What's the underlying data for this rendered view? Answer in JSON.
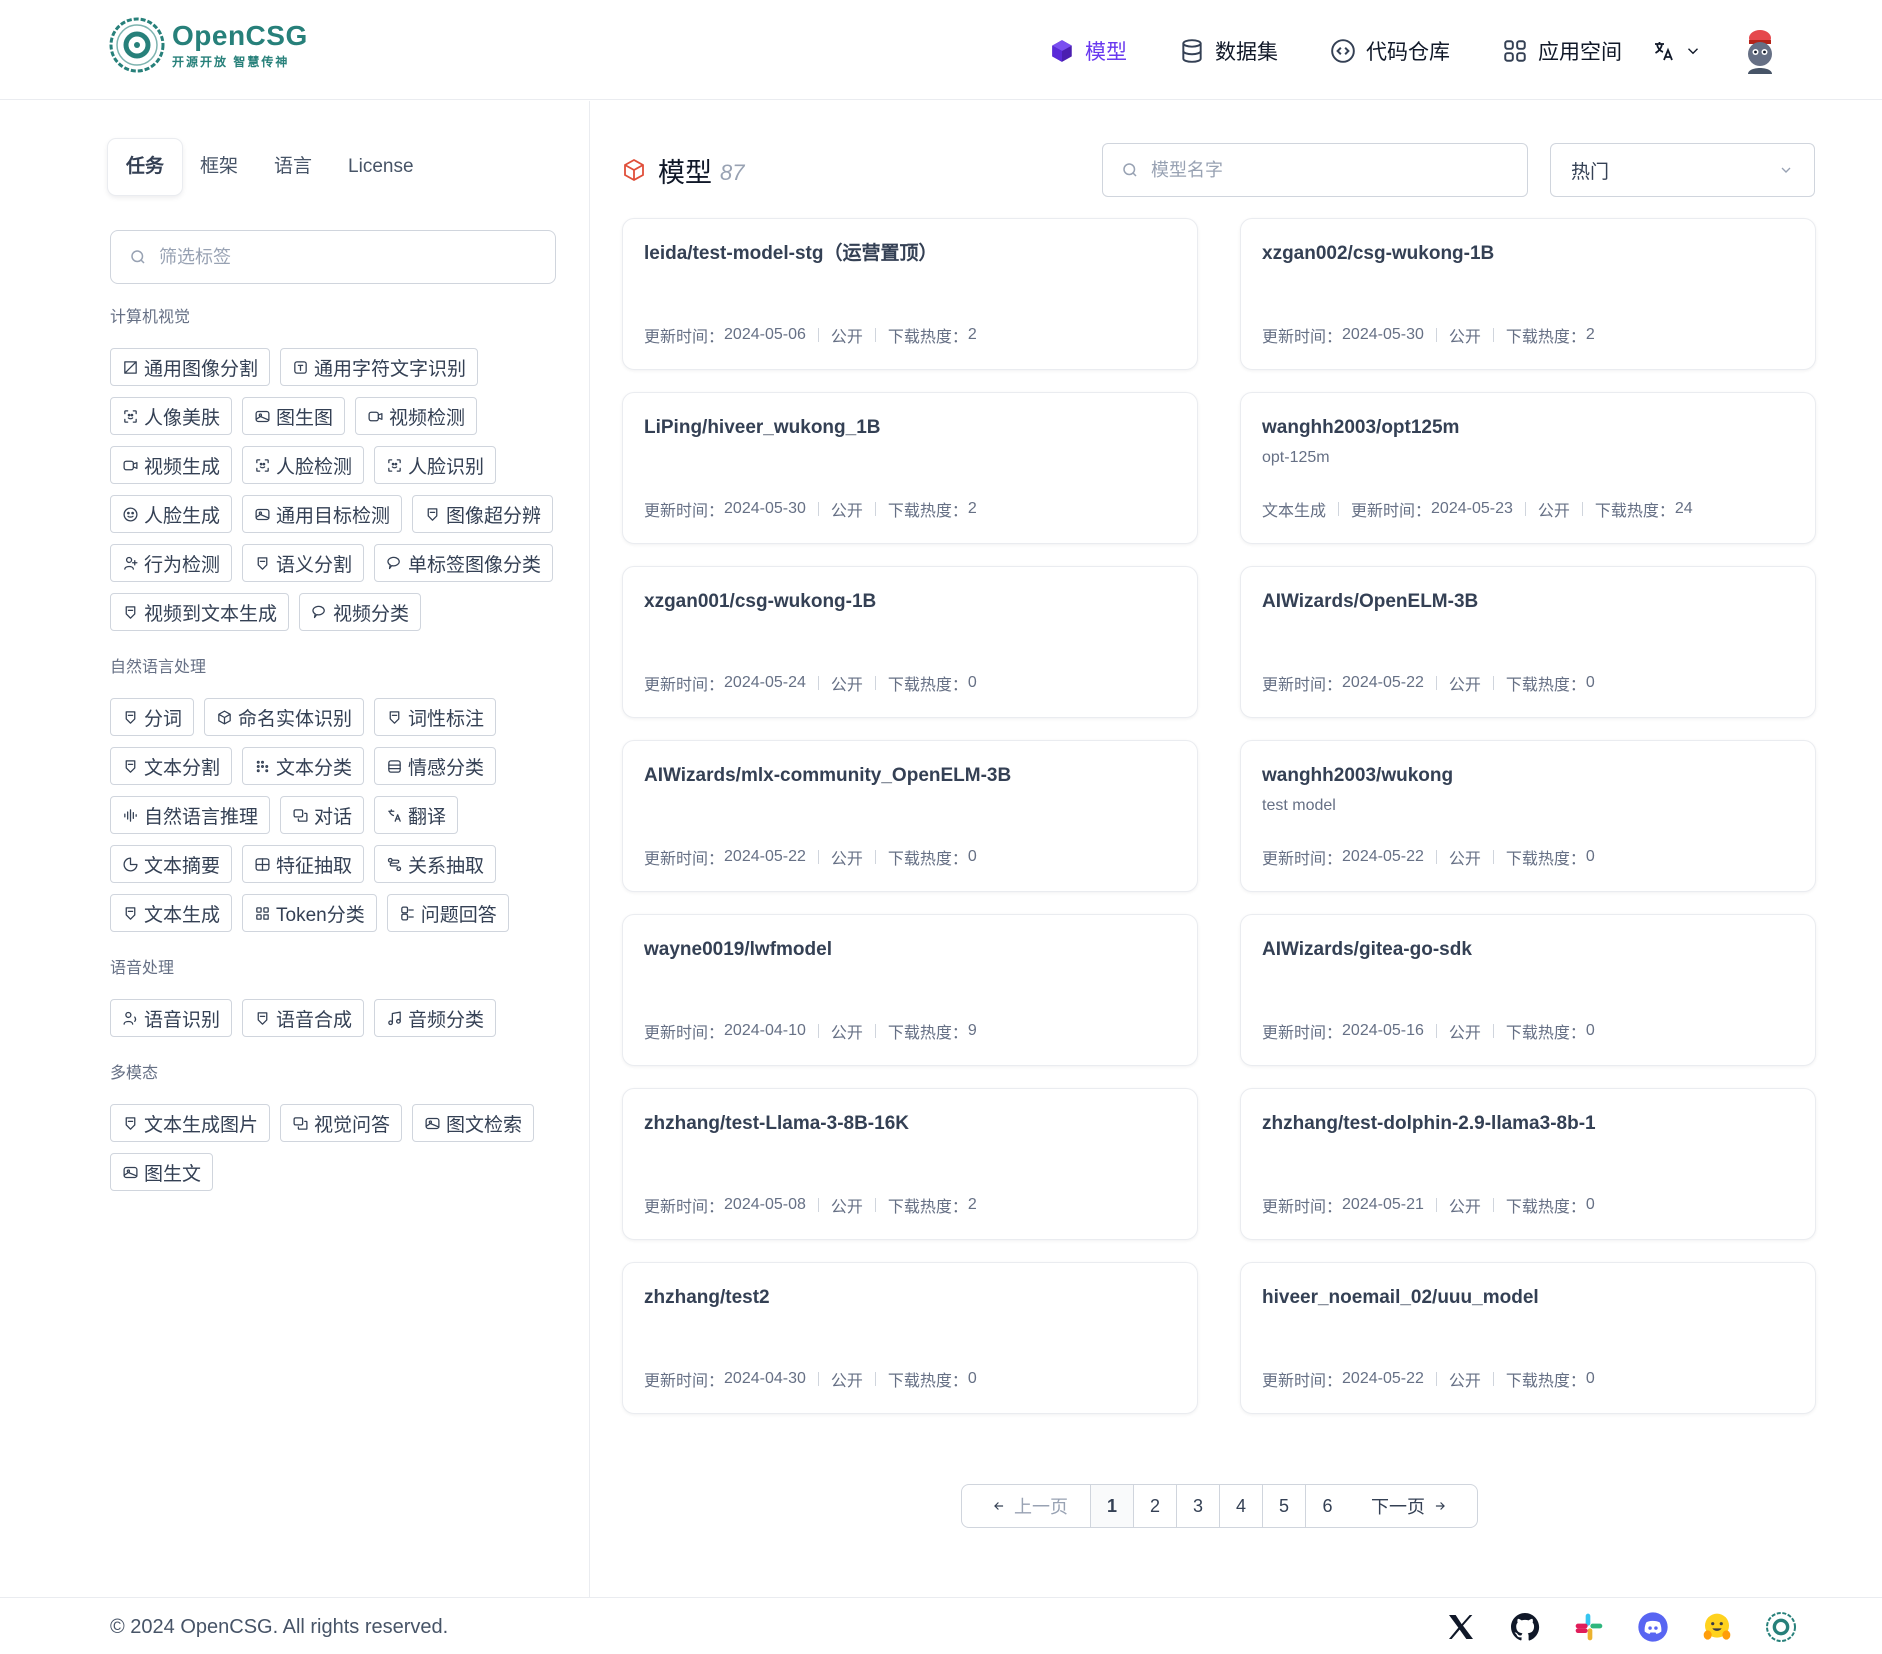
{
  "brand": {
    "name": "OpenCSG",
    "slogan": "开源开放 智慧传神",
    "accent": "#6938ef",
    "logo_color": "#27807a"
  },
  "nav": {
    "items": [
      {
        "label": "模型",
        "icon": "cube-icon",
        "active": true
      },
      {
        "label": "数据集",
        "icon": "database-icon",
        "active": false
      },
      {
        "label": "代码仓库",
        "icon": "code-icon",
        "active": false
      },
      {
        "label": "应用空间",
        "icon": "grid-icon",
        "active": false
      }
    ],
    "language_icon": "translate-icon",
    "avatar_icon": "user-avatar"
  },
  "sidebar": {
    "tabs": [
      "任务",
      "框架",
      "语言",
      "License"
    ],
    "active_tab": 0,
    "filter_placeholder": "筛选标签",
    "groups": [
      {
        "title": "计算机视觉",
        "tags": [
          "通用图像分割",
          "通用字符文字识别",
          "人像美肤",
          "图生图",
          "视频检测",
          "视频生成",
          "人脸检测",
          "人脸识别",
          "人脸生成",
          "通用目标检测",
          "图像超分辨",
          "行为检测",
          "语义分割",
          "单标签图像分类",
          "视频到文本生成",
          "视频分类"
        ]
      },
      {
        "title": "自然语言处理",
        "tags": [
          "分词",
          "命名实体识别",
          "词性标注",
          "文本分割",
          "文本分类",
          "情感分类",
          "自然语言推理",
          "对话",
          "翻译",
          "文本摘要",
          "特征抽取",
          "关系抽取",
          "文本生成",
          "Token分类",
          "问题回答"
        ]
      },
      {
        "title": "语音处理",
        "tags": [
          "语音识别",
          "语音合成",
          "音频分类"
        ]
      },
      {
        "title": "多模态",
        "tags": [
          "文本生成图片",
          "视觉问答",
          "图文检索",
          "图生文"
        ]
      }
    ]
  },
  "main": {
    "title": "模型",
    "count": "87",
    "search_placeholder": "模型名字",
    "sort_value": "热门",
    "meta_labels": {
      "updated": "更新时间：",
      "public": "公开",
      "downloads": "下载热度："
    },
    "models": [
      {
        "name": "leida/test-model-stg（运营置顶）",
        "desc": "",
        "task": "",
        "updated": "2024-05-06",
        "downloads": "2"
      },
      {
        "name": "xzgan002/csg-wukong-1B",
        "desc": "",
        "task": "",
        "updated": "2024-05-30",
        "downloads": "2"
      },
      {
        "name": "LiPing/hiveer_wukong_1B",
        "desc": "",
        "task": "",
        "updated": "2024-05-30",
        "downloads": "2"
      },
      {
        "name": "wanghh2003/opt125m",
        "desc": "opt-125m",
        "task": "文本生成",
        "updated": "2024-05-23",
        "downloads": "24"
      },
      {
        "name": "xzgan001/csg-wukong-1B",
        "desc": "",
        "task": "",
        "updated": "2024-05-24",
        "downloads": "0"
      },
      {
        "name": "AIWizards/OpenELM-3B",
        "desc": "",
        "task": "",
        "updated": "2024-05-22",
        "downloads": "0"
      },
      {
        "name": "AIWizards/mlx-community_OpenELM-3B",
        "desc": "",
        "task": "",
        "updated": "2024-05-22",
        "downloads": "0"
      },
      {
        "name": "wanghh2003/wukong",
        "desc": "test model",
        "task": "",
        "updated": "2024-05-22",
        "downloads": "0"
      },
      {
        "name": "wayne0019/lwfmodel",
        "desc": "",
        "task": "",
        "updated": "2024-04-10",
        "downloads": "9"
      },
      {
        "name": "AIWizards/gitea-go-sdk",
        "desc": "",
        "task": "",
        "updated": "2024-05-16",
        "downloads": "0"
      },
      {
        "name": "zhzhang/test-Llama-3-8B-16K",
        "desc": "",
        "task": "",
        "updated": "2024-05-08",
        "downloads": "2"
      },
      {
        "name": "zhzhang/test-dolphin-2.9-llama3-8b-1",
        "desc": "",
        "task": "",
        "updated": "2024-05-21",
        "downloads": "0"
      },
      {
        "name": "zhzhang/test2",
        "desc": "",
        "task": "",
        "updated": "2024-04-30",
        "downloads": "0"
      },
      {
        "name": "hiveer_noemail_02/uuu_model",
        "desc": "",
        "task": "",
        "updated": "2024-05-22",
        "downloads": "0"
      }
    ]
  },
  "pagination": {
    "prev": "上一页",
    "next": "下一页",
    "pages": [
      "1",
      "2",
      "3",
      "4",
      "5",
      "6"
    ],
    "current": "1"
  },
  "footer": {
    "copyright": "© 2024 OpenCSG. All rights reserved.",
    "socials": [
      "x-icon",
      "github-icon",
      "slack-icon",
      "discord-icon",
      "huggingface-icon",
      "opencsg-icon"
    ]
  }
}
